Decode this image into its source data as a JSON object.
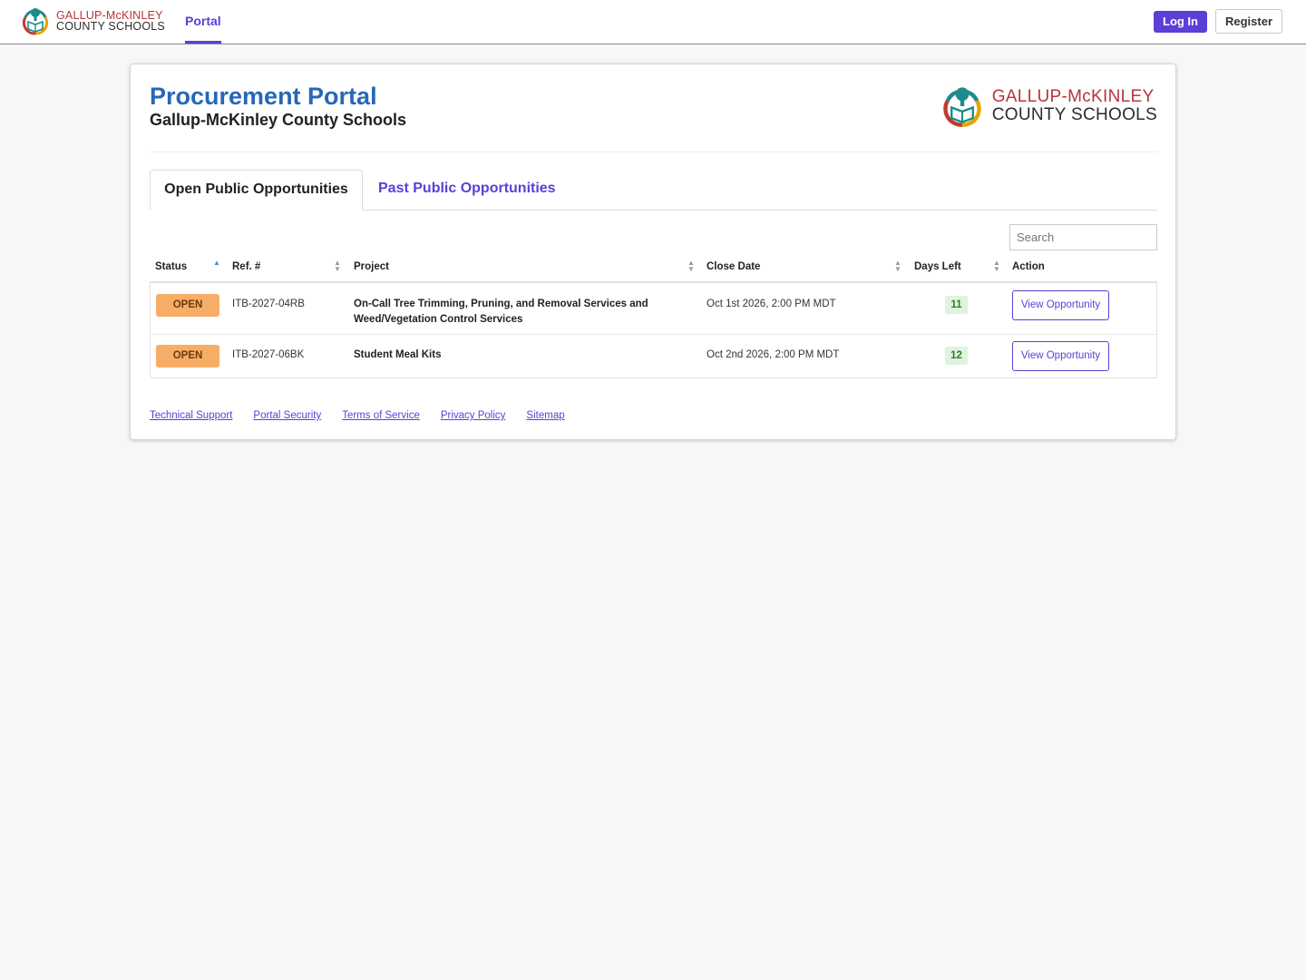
{
  "nav": {
    "logo_line1": "GALLUP-McKINLEY",
    "logo_line2": "COUNTY SCHOOLS",
    "tab": "Portal",
    "login": "Log In",
    "register": "Register"
  },
  "header": {
    "title": "Procurement Portal",
    "subtitle": "Gallup-McKinley County Schools",
    "logo_line1": "GALLUP-McKINLEY",
    "logo_line2": "COUNTY SCHOOLS"
  },
  "tabs": {
    "open": "Open Public Opportunities",
    "past": "Past Public Opportunities"
  },
  "search": {
    "placeholder": "Search"
  },
  "table": {
    "columns": [
      "Status",
      "Ref. #",
      "Project",
      "Close Date",
      "Days Left",
      "Action"
    ],
    "rows": [
      {
        "status": "OPEN",
        "ref": "ITB-2027-04RB",
        "project": "On-Call Tree Trimming, Pruning, and Removal Services and Weed/Vegetation Control Services",
        "close_date": "Oct 1st 2026, 2:00 PM MDT",
        "days_left": "11",
        "action": "View Opportunity"
      },
      {
        "status": "OPEN",
        "ref": "ITB-2027-06BK",
        "project": "Student Meal Kits",
        "close_date": "Oct 2nd 2026, 2:00 PM MDT",
        "days_left": "12",
        "action": "View Opportunity"
      }
    ]
  },
  "footer": {
    "links": [
      "Technical Support",
      "Portal Security",
      "Terms of Service",
      "Privacy Policy",
      "Sitemap"
    ]
  },
  "colors": {
    "accent": "#5b3fd6",
    "title_blue": "#2767b7",
    "open_badge": "#f7ad65",
    "days_bg": "#dff3df",
    "logo_red": "#b8343a"
  }
}
